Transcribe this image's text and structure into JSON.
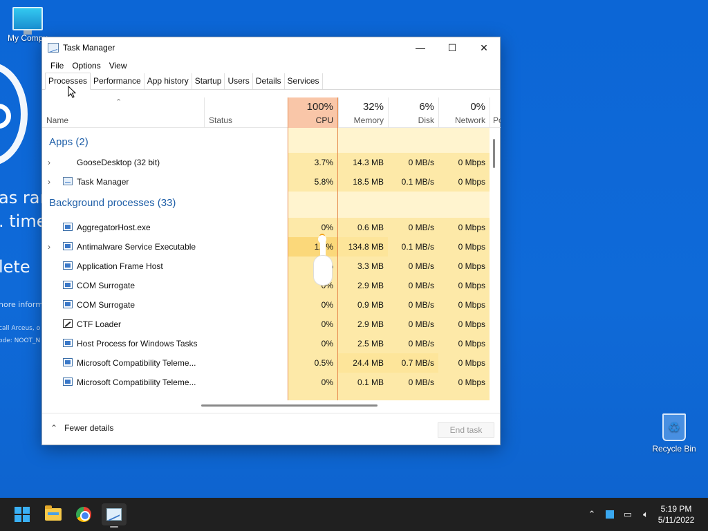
{
  "desktop": {
    "icons": [
      {
        "label": "My Compu"
      },
      {
        "label": "Recycle Bin"
      }
    ],
    "background_text": {
      "line1": "as rar",
      "line2": ". time",
      "line3": "lete",
      "line4": "nore informa",
      "line5": "call Arceus, o",
      "line6": "ode: NOOT_N"
    }
  },
  "window": {
    "title": "Task Manager",
    "controls": {
      "minimize": "—",
      "maximize": "☐",
      "close": "✕"
    },
    "menu": [
      "File",
      "Options",
      "View"
    ],
    "tabs": [
      {
        "label": "Processes",
        "active": true
      },
      {
        "label": "Performance"
      },
      {
        "label": "App history"
      },
      {
        "label": "Startup"
      },
      {
        "label": "Users"
      },
      {
        "label": "Details"
      },
      {
        "label": "Services"
      }
    ],
    "columns": {
      "name": {
        "label": "Name"
      },
      "status": {
        "label": "Status"
      },
      "cpu": {
        "pct": "100%",
        "label": "CPU"
      },
      "memory": {
        "pct": "32%",
        "label": "Memory"
      },
      "disk": {
        "pct": "6%",
        "label": "Disk"
      },
      "network": {
        "pct": "0%",
        "label": "Network"
      },
      "power": {
        "label": "Po"
      }
    },
    "groups": {
      "apps": "Apps (2)",
      "background": "Background processes (33)"
    },
    "apps": [
      {
        "name": "GooseDesktop (32 bit)",
        "cpu": "3.7%",
        "memory": "14.3 MB",
        "disk": "0 MB/s",
        "network": "0 Mbps",
        "icon": "goose-icon"
      },
      {
        "name": "Task Manager",
        "cpu": "5.8%",
        "memory": "18.5 MB",
        "disk": "0.1 MB/s",
        "network": "0 Mbps",
        "icon": "task-manager-icon"
      }
    ],
    "background": [
      {
        "name": "AggregatorHost.exe",
        "cpu": "0%",
        "memory": "0.6 MB",
        "disk": "0 MB/s",
        "network": "0 Mbps",
        "expandable": false
      },
      {
        "name": "Antimalware Service Executable",
        "cpu": "1.3%",
        "memory": "134.8 MB",
        "disk": "0.1 MB/s",
        "network": "0 Mbps",
        "expandable": true
      },
      {
        "name": "Application Frame Host",
        "cpu": "0%",
        "memory": "3.3 MB",
        "disk": "0 MB/s",
        "network": "0 Mbps",
        "expandable": false
      },
      {
        "name": "COM Surrogate",
        "cpu": "0%",
        "memory": "2.9 MB",
        "disk": "0 MB/s",
        "network": "0 Mbps",
        "expandable": false
      },
      {
        "name": "COM Surrogate",
        "cpu": "0%",
        "memory": "0.9 MB",
        "disk": "0 MB/s",
        "network": "0 Mbps",
        "expandable": false
      },
      {
        "name": "CTF Loader",
        "cpu": "0%",
        "memory": "2.9 MB",
        "disk": "0 MB/s",
        "network": "0 Mbps",
        "expandable": false
      },
      {
        "name": "Host Process for Windows Tasks",
        "cpu": "0%",
        "memory": "2.5 MB",
        "disk": "0 MB/s",
        "network": "0 Mbps",
        "expandable": false
      },
      {
        "name": "Microsoft Compatibility Teleme...",
        "cpu": "0.5%",
        "memory": "24.4 MB",
        "disk": "0.7 MB/s",
        "network": "0 Mbps",
        "expandable": false
      },
      {
        "name": "Microsoft Compatibility Teleme...",
        "cpu": "0%",
        "memory": "0.1 MB",
        "disk": "0 MB/s",
        "network": "0 Mbps",
        "expandable": false
      }
    ],
    "footer": {
      "fewer_details": "Fewer details",
      "end_task": "End task"
    }
  },
  "taskbar": {
    "apps": [
      "start-icon",
      "file-explorer-icon",
      "chrome-icon",
      "task-manager-icon"
    ],
    "tray": [
      "chevron-up-icon",
      "app-tray-icon",
      "network-icon",
      "volume-icon"
    ],
    "time": "5:19 PM",
    "date": "5/11/2022"
  },
  "colors": {
    "desktop_blue": "#0f6ad8",
    "cpu_header": "#f9c6a8",
    "heat_low": "#fff4cf",
    "heat_mid": "#fde9a8",
    "group_title": "#1f5fa8",
    "taskbar": "#202020"
  }
}
